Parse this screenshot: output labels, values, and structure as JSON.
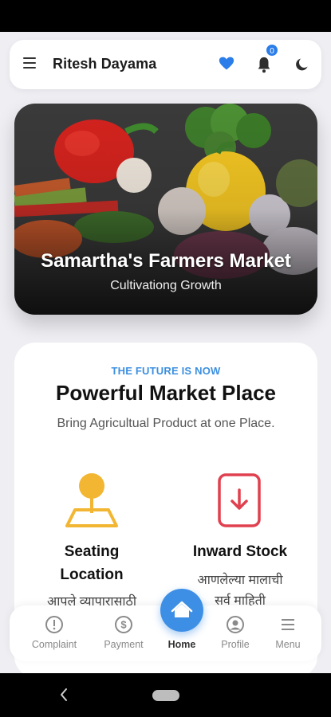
{
  "header": {
    "title": "Ritesh Dayama",
    "notification_count": "0",
    "icons": [
      "menu-icon",
      "heart-icon",
      "bell-icon",
      "moon-icon"
    ]
  },
  "hero": {
    "title": "Samartha's Farmers Market",
    "subtitle": "Cultivationg Growth"
  },
  "intro": {
    "eyebrow": "THE FUTURE IS NOW",
    "title": "Powerful Market Place",
    "subtitle": "Bring Agricultual Product at one Place."
  },
  "features": [
    {
      "title_line1": "Seating",
      "title_line2": "Location",
      "desc": "आपले व्यापारासाठी",
      "icon": "map-pin-icon",
      "color": "#f2b632"
    },
    {
      "title_line1": "Inward Stock",
      "title_line2": "",
      "desc_line1": "आणलेल्या मालाची",
      "desc_line2": "सर्व माहिती",
      "icon": "inward-stock-icon",
      "color": "#e0404f"
    }
  ],
  "bottom_nav": {
    "items": [
      {
        "label": "Complaint",
        "icon": "alert-circle-icon"
      },
      {
        "label": "Payment",
        "icon": "dollar-icon"
      },
      {
        "label": "Home",
        "icon": "home-icon"
      },
      {
        "label": "Profile",
        "icon": "user-icon"
      },
      {
        "label": "Menu",
        "icon": "menu-lines-icon"
      }
    ]
  },
  "colors": {
    "accent": "#3d8fe6",
    "badge": "#2b7de9",
    "feature_yellow": "#f2b632",
    "feature_red": "#e0404f"
  }
}
